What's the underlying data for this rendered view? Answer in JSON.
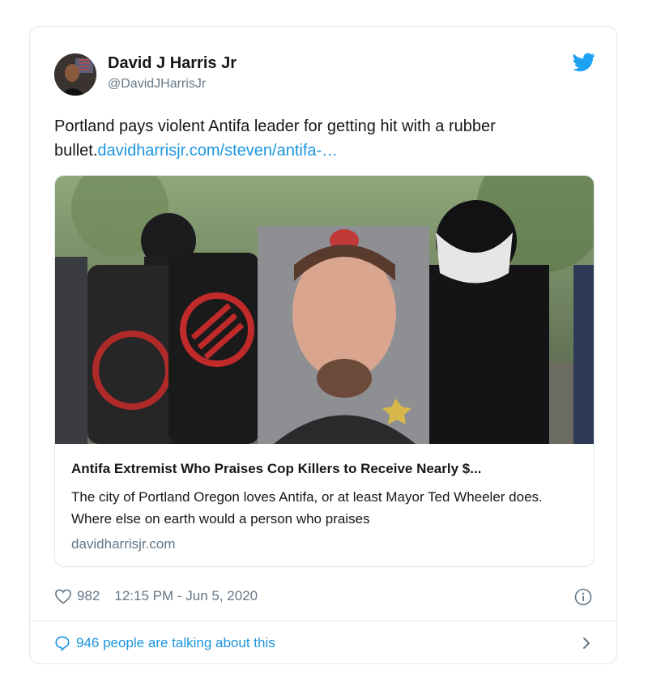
{
  "tweet": {
    "author_name": "David J Harris Jr",
    "author_handle": "@DavidJHarrisJr",
    "text": "Portland pays violent Antifa leader for getting hit with a rubber bullet.",
    "link_text": "davidharrisjr.com/steven/antifa-…",
    "like_count": "982",
    "timestamp": "12:15 PM - Jun 5, 2020",
    "talking": "946 people are talking about this"
  },
  "link_card": {
    "title": "Antifa Extremist Who Praises Cop Killers to Receive Nearly $...",
    "description": "The city of Portland Oregon loves Antifa, or at least Mayor Ted Wheeler does. Where else on earth would a person who praises",
    "domain": "davidharrisjr.com"
  },
  "icons": {
    "brand": "twitter-bird-icon",
    "like": "heart-icon",
    "info": "info-icon",
    "reply": "speech-bubble-icon",
    "more": "chevron-right-icon"
  },
  "colors": {
    "link": "#1b95e0",
    "muted": "#657786",
    "border": "#e1e8ed",
    "text": "#14171a"
  }
}
